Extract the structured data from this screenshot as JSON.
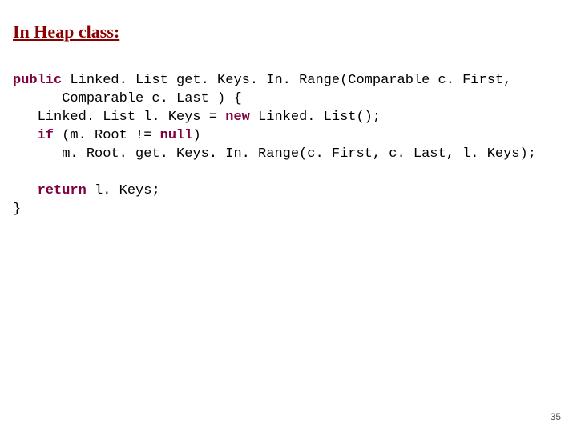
{
  "heading": "In Heap class:",
  "code": {
    "kw_public": "public",
    "line1_rest": " Linked. List get. Keys. In. Range(Comparable c. First,",
    "line2": "      Comparable c. Last ) {",
    "line3_a": "   Linked. List l. Keys = ",
    "kw_new": "new",
    "line3_b": " Linked. List();",
    "line4_a": "   ",
    "kw_if": "if",
    "line4_b": " (m. Root != ",
    "kw_null": "null",
    "line4_c": ")",
    "line5": "      m. Root. get. Keys. In. Range(c. First, c. Last, l. Keys);",
    "line7_a": "   ",
    "kw_return": "return",
    "line7_b": " l. Keys;",
    "line8": "}"
  },
  "page_number": "35"
}
